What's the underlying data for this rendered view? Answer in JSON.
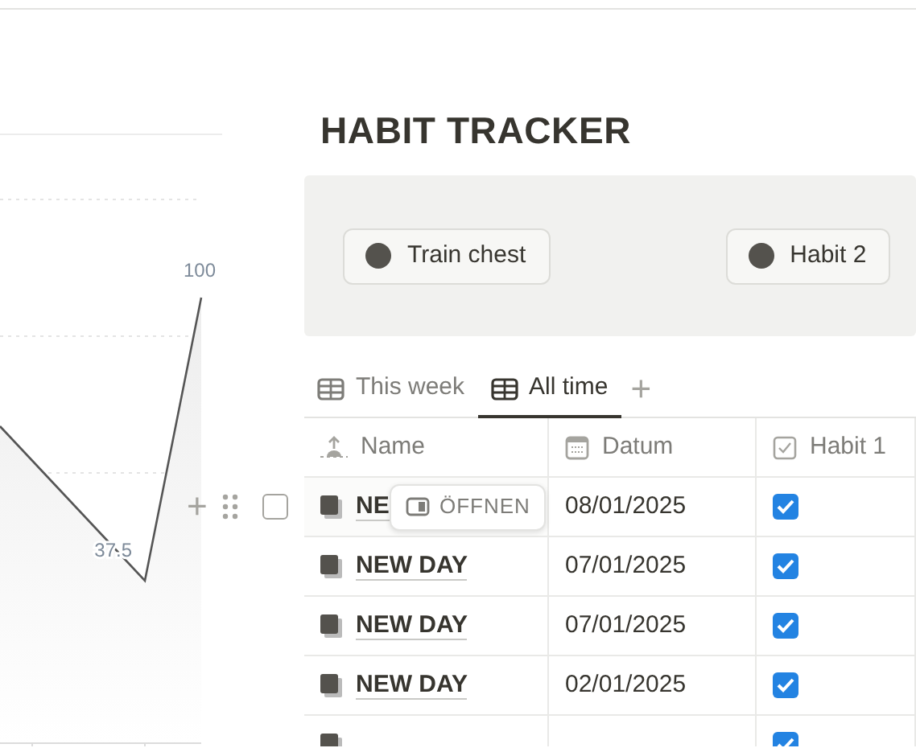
{
  "chart": {
    "point_labels": [
      "100",
      "37.5"
    ]
  },
  "title": "HABIT TRACKER",
  "habit_buttons": [
    "Train chest",
    "Habit 2"
  ],
  "tabs": [
    {
      "label": "This week",
      "selected": false
    },
    {
      "label": "All time",
      "selected": true
    }
  ],
  "add_tab": "+",
  "table": {
    "columns": [
      {
        "label": "Name",
        "kind": "title"
      },
      {
        "label": "Datum",
        "kind": "date"
      },
      {
        "label": "Habit 1",
        "kind": "checkbox"
      }
    ],
    "rows": [
      {
        "name": "NE",
        "date": "08/01/2025",
        "habit_1": true,
        "hovered": true
      },
      {
        "name": "NEW DAY",
        "date": "07/01/2025",
        "habit_1": true,
        "hovered": false
      },
      {
        "name": "NEW DAY",
        "date": "07/01/2025",
        "habit_1": true,
        "hovered": false
      },
      {
        "name": "NEW DAY",
        "date": "02/01/2025",
        "habit_1": true,
        "hovered": false
      },
      {
        "habit_1": true,
        "hovered": false
      }
    ]
  },
  "row_hover": {
    "add": "+",
    "selected": false,
    "open_label": "ÖFFNEN"
  }
}
